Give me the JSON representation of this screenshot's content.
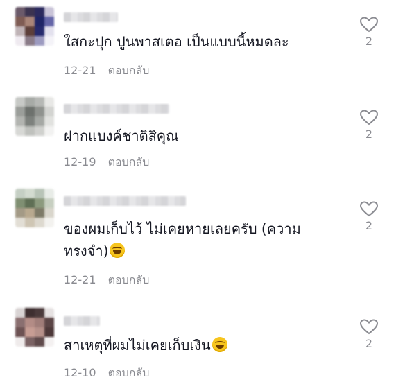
{
  "comments": [
    {
      "text": "ใสกะปุก ปูนพาสเตอ เป็นแบบนี้หมดละ",
      "date": "12-21",
      "reply_label": "ตอบกลับ",
      "likes": "2",
      "has_emoji": false
    },
    {
      "text": "ฝากแบงค์ชาติสิคุณ",
      "date": "12-19",
      "reply_label": "ตอบกลับ",
      "likes": "2",
      "has_emoji": false
    },
    {
      "text_line1": "ของผมเก็บไว้ ไม่เคยหายเลยครับ (ความ",
      "text_line2": "ทรงจำ)",
      "date": "12-21",
      "reply_label": "ตอบกลับ",
      "likes": "2",
      "has_emoji": true
    },
    {
      "text": "สาเหตุที่ผมไม่เคยเก็บเงิน",
      "date": "12-10",
      "reply_label": "ตอบกลับ",
      "likes": "2",
      "has_emoji": true
    }
  ],
  "icons": {
    "like": "heart-outline-icon",
    "emoji": "laughing-emoji"
  },
  "colors": {
    "text": "#161823",
    "meta": "#8a8b91",
    "heart_stroke": "#8a8b91"
  }
}
